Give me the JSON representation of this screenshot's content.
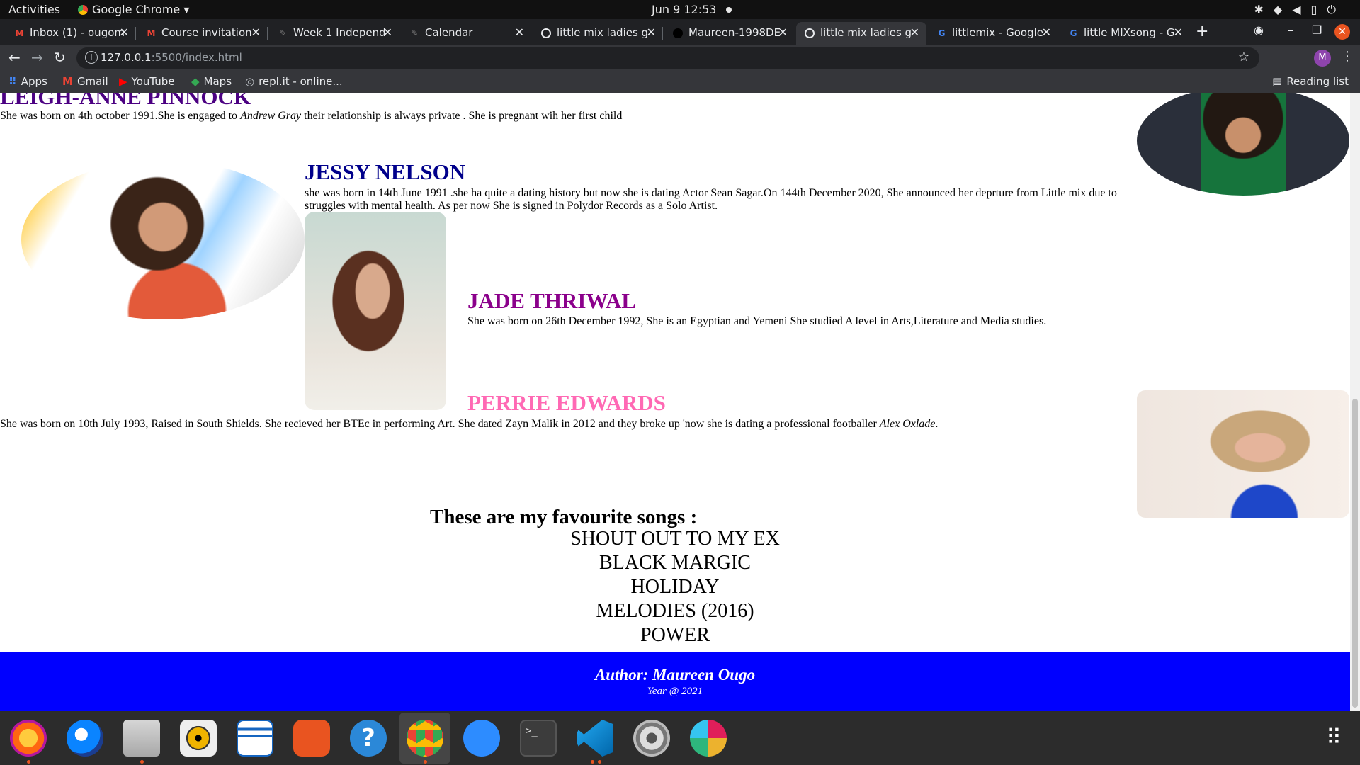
{
  "system_bar": {
    "activities": "Activities",
    "app_menu": "Google Chrome ▾",
    "clock": "Jun 9  12:53",
    "tray_icons": [
      "slack-icon",
      "wifi-icon",
      "volume-icon",
      "battery-icon",
      "power-icon"
    ]
  },
  "tabs": [
    {
      "title": "Inbox (1) - ougom",
      "icon": "gmail-icon",
      "active": false
    },
    {
      "title": "Course invitation",
      "icon": "gmail-icon",
      "active": false
    },
    {
      "title": "Week 1 Independ",
      "icon": "feather-icon",
      "active": false
    },
    {
      "title": "Calendar",
      "icon": "feather-icon",
      "active": false
    },
    {
      "title": "little mix ladies g",
      "icon": "globe-icon",
      "active": false
    },
    {
      "title": "Maureen-1998DE",
      "icon": "github-icon",
      "active": false
    },
    {
      "title": "little mix ladies g",
      "icon": "globe-icon",
      "active": true
    },
    {
      "title": "littlemix - Google",
      "icon": "google-icon",
      "active": false
    },
    {
      "title": "little MIXsong - G",
      "icon": "google-icon",
      "active": false
    }
  ],
  "toolbar": {
    "url_host": "127.0.0.1",
    "url_rest": ":5500/index.html",
    "profile_initial": "M"
  },
  "bookmarks": [
    {
      "label": "Apps",
      "icon": "apps-grid-icon"
    },
    {
      "label": "Gmail",
      "icon": "gmail-icon"
    },
    {
      "label": "YouTube",
      "icon": "youtube-icon"
    },
    {
      "label": "Maps",
      "icon": "maps-icon"
    },
    {
      "label": "repl.it - online...",
      "icon": "replit-icon"
    }
  ],
  "reading_list": "Reading list",
  "members": {
    "leigh": {
      "name": "LEIGH-ANNE PINNOCK",
      "bio_a": "She was born on 4th october 1991.She is engaged to ",
      "bio_em": "Andrew Gray",
      "bio_b": " their relationship is always private . She is pregnant wih her first child",
      "color": "#4b0082"
    },
    "jessy": {
      "name": "JESSY NELSON",
      "bio": "she was born in 14th June 1991 .she ha quite a dating history but now she is dating Actor Sean Sagar.On 144th December 2020, She announced her deprture from Little mix due to struggles with mental health. As per now She is signed in Polydor Records as a Solo Artist.",
      "color": "#00008b"
    },
    "jade": {
      "name": "JADE THRIWAL",
      "bio": "She was born on 26th December 1992, She is an Egyptian and Yemeni She studied A level in Arts,Literature and Media studies.",
      "color": "#8b008b"
    },
    "perrie": {
      "name": "PERRIE EDWARDS",
      "bio_a": "She was born on 10th July 1993, Raised in South Shields. She recieved her BTEc in performing Art. She dated Zayn Malik in 2012 and they broke up 'now she is dating a professional footballer ",
      "bio_em": "Alex Oxlade",
      "bio_b": ".",
      "color": "#ff69b4"
    }
  },
  "songs": {
    "title": "These are my favourite songs :",
    "items": [
      "SHOUT OUT TO MY EX",
      "BLACK MARGIC",
      "HOLIDAY",
      "MELODIES (2016)",
      "POWER"
    ]
  },
  "footer": {
    "author": "Author: Maureen Ougo",
    "year": "Year @ 2021",
    "background": "#0000ff"
  },
  "dock_apps": [
    "firefox-icon",
    "thunderbird-icon",
    "files-icon",
    "rhythmbox-icon",
    "writer-icon",
    "software-icon",
    "help-icon",
    "chrome-icon",
    "zoom-icon",
    "terminal-icon",
    "vscode-icon",
    "settings-icon",
    "slack-icon",
    "app-grid-icon"
  ]
}
